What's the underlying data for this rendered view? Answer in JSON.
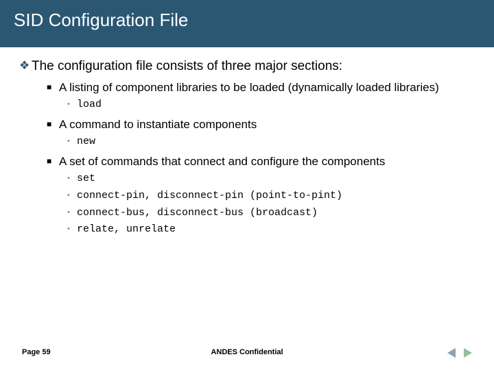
{
  "title": "SID Configuration File",
  "lvl1_text": "The configuration file consists of three major sections:",
  "sections": [
    {
      "text": "A listing of component libraries to be loaded (dynamically loaded libraries)",
      "commands": [
        "load"
      ]
    },
    {
      "text": "A command to instantiate components",
      "commands": [
        "new"
      ]
    },
    {
      "text": "A set of commands that connect and configure the components",
      "commands": [
        "set",
        "connect-pin, disconnect-pin (point-to-pint)",
        "connect-bus, disconnect-bus (broadcast)",
        "relate, unrelate"
      ]
    }
  ],
  "footer": {
    "page_label": "Page 59",
    "confidential": "ANDES Confidential"
  }
}
